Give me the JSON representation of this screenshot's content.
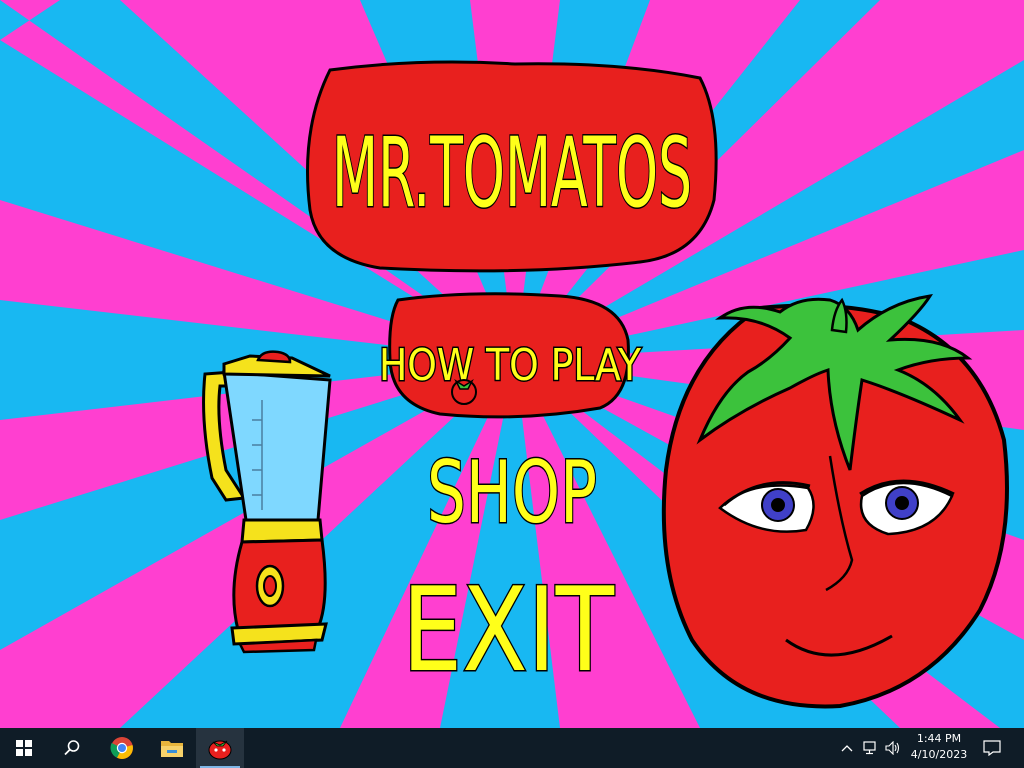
{
  "game": {
    "title": "MR.TOMATOS",
    "menu": {
      "how_to_play": "HOW TO PLAY",
      "shop": "SHOP",
      "exit": "EXIT"
    }
  },
  "colors": {
    "ray_pink": "#ff3fd0",
    "ray_blue": "#18b8f2",
    "tomato_red": "#e8201e",
    "title_yellow": "#ffff1a",
    "leaf_green": "#3cc23c",
    "taskbar": "#0f1c27"
  },
  "taskbar": {
    "apps": [
      {
        "icon": "windows-start-icon"
      },
      {
        "icon": "search-icon"
      },
      {
        "icon": "chrome-icon"
      },
      {
        "icon": "file-explorer-icon"
      },
      {
        "icon": "mr-tomatos-app-icon"
      }
    ],
    "tray": {
      "icons": [
        "chevron-up-icon",
        "network-icon",
        "volume-icon"
      ],
      "time": "1:44 PM",
      "date": "4/10/2023",
      "notification_icon": "notification-icon"
    }
  }
}
